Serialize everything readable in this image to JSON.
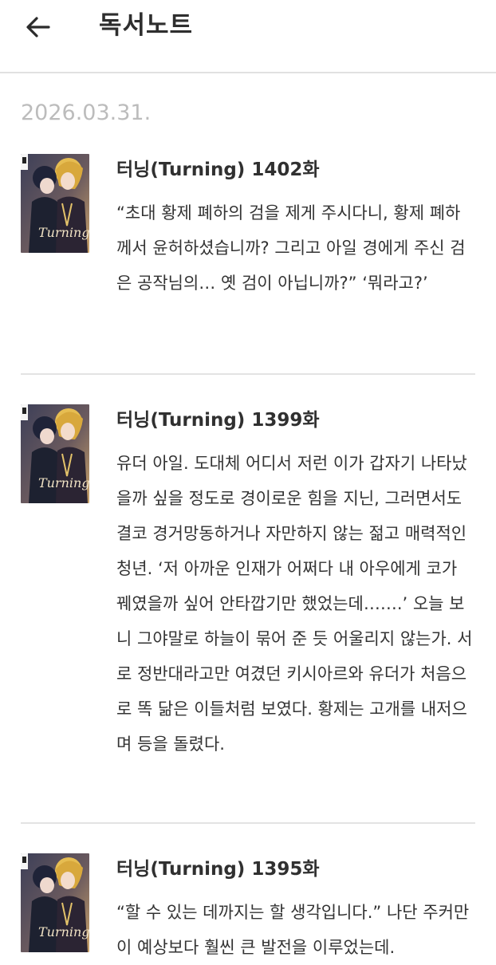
{
  "header": {
    "back_icon": "arrow-left-icon",
    "title": "독서노트"
  },
  "date": "2026.03.31.",
  "notes": [
    {
      "title": "터닝(Turning) 1402화",
      "text": "“초대 황제 폐하의 검을 제게 주시다니, 황제 폐하께서 윤허하셨습니까? 그리고 아일 경에게 주신 검은 공작님의… 옛 검이 아닙니까?” ‘뭐라고?’"
    },
    {
      "title": "터닝(Turning) 1399화",
      "text": "유더 아일. 도대체 어디서 저런 이가 갑자기 나타났을까 싶을 정도로 경이로운 힘을 지닌, 그러면서도 결코 경거망동하거나 자만하지 않는 젊고 매력적인 청년. ‘저 아까운 인재가 어쩌다 내 아우에게 코가 꿰였을까 싶어 안타깝기만 했었는데…….’ 오늘 보니 그야말로 하늘이 묶어 준 듯 어울리지 않는가. 서로 정반대라고만 여겼던 키시아르와 유더가 처음으로 똑 닮은 이들처럼 보였다. 황제는 고개를 내저으며 등을 돌렸다."
    },
    {
      "title": "터닝(Turning) 1395화",
      "text": "“할 수 있는 데까지는 할 생각입니다.” 나단 주커만이 예상보다 훨씬 큰 발전을 이루었는데."
    }
  ],
  "colors": {
    "date": "#bcbcbc",
    "divider": "#e3e3e3",
    "text": "#333333"
  }
}
